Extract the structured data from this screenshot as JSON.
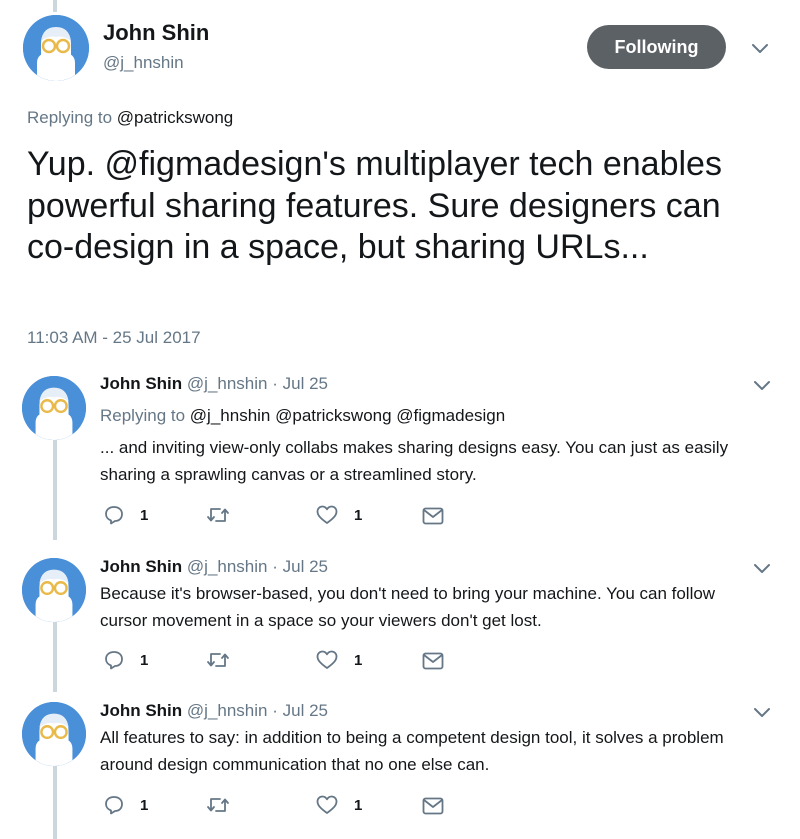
{
  "main_tweet": {
    "name": "John Shin",
    "handle": "@j_hnshin",
    "follow_label": "Following",
    "replying_prefix": "Replying to",
    "replying_to": "@patrickswong",
    "text_before": "Yup. ",
    "text_mention": "@figmadesign",
    "text_after": "'s multiplayer tech enables powerful sharing features. Sure designers can co-design in a space, but sharing URLs...",
    "timestamp": "11:03 AM - 25 Jul 2017"
  },
  "replies": [
    {
      "name": "John Shin",
      "handle": "@j_hnshin",
      "date": "· Jul 25",
      "replying_prefix": "Replying to",
      "replying_to": "@j_hnshin @patrickswong @figmadesign",
      "text": "... and inviting view-only collabs makes sharing designs easy. You can just as easily sharing a sprawling canvas or a streamlined story.",
      "reply_count": "1",
      "like_count": "1"
    },
    {
      "name": "John Shin",
      "handle": "@j_hnshin",
      "date": "· Jul 25",
      "text": "Because it's browser-based, you don't need to bring your machine. You can follow cursor movement in a space so your viewers don't get lost.",
      "reply_count": "1",
      "like_count": "1"
    },
    {
      "name": "John Shin",
      "handle": "@j_hnshin",
      "date": "· Jul 25",
      "text": "All features to say: in addition to being a competent design tool, it solves a problem around design communication that no one else can.",
      "reply_count": "1",
      "like_count": "1"
    }
  ],
  "colors": {
    "avatar_bg": "#4a90d9",
    "follow_bg": "#5c6166",
    "muted": "#657786",
    "text": "#14171a",
    "thread_line": "#ccd6dd",
    "icon": "#657786"
  },
  "icons": {
    "reply": "reply-icon",
    "retweet": "retweet-icon",
    "like": "heart-icon",
    "dm": "envelope-icon",
    "more": "chevron-down-icon"
  }
}
